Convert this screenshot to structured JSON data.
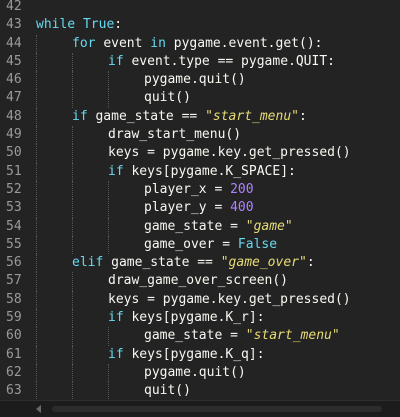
{
  "editor": {
    "lines": [
      {
        "n": "42",
        "indent": 0,
        "tokens": []
      },
      {
        "n": "43",
        "indent": 0,
        "tokens": [
          [
            "kw",
            "while "
          ],
          [
            "kw",
            "True"
          ],
          [
            "pl",
            ":"
          ]
        ]
      },
      {
        "n": "44",
        "indent": 1,
        "tokens": [
          [
            "kw",
            "for "
          ],
          [
            "pl",
            "event "
          ],
          [
            "kw",
            "in "
          ],
          [
            "pl",
            "pygame.event.get():"
          ]
        ]
      },
      {
        "n": "45",
        "indent": 2,
        "tokens": [
          [
            "kw",
            "if "
          ],
          [
            "pl",
            "event.type == pygame.QUIT:"
          ]
        ]
      },
      {
        "n": "46",
        "indent": 3,
        "tokens": [
          [
            "pl",
            "pygame.quit()"
          ]
        ]
      },
      {
        "n": "47",
        "indent": 3,
        "tokens": [
          [
            "pl",
            "quit()"
          ]
        ]
      },
      {
        "n": "48",
        "indent": 1,
        "tokens": [
          [
            "kw",
            "if "
          ],
          [
            "pl",
            "game_state == "
          ],
          [
            "str",
            "\"start_menu\""
          ],
          [
            "pl",
            ":"
          ]
        ]
      },
      {
        "n": "49",
        "indent": 2,
        "tokens": [
          [
            "pl",
            "draw_start_menu()"
          ]
        ]
      },
      {
        "n": "50",
        "indent": 2,
        "tokens": [
          [
            "pl",
            "keys = pygame.key.get_pressed()"
          ]
        ]
      },
      {
        "n": "51",
        "indent": 2,
        "tokens": [
          [
            "kw",
            "if "
          ],
          [
            "pl",
            "keys[pygame.K_SPACE]:"
          ]
        ]
      },
      {
        "n": "52",
        "indent": 3,
        "tokens": [
          [
            "pl",
            "player_x = "
          ],
          [
            "num",
            "200"
          ]
        ]
      },
      {
        "n": "53",
        "indent": 3,
        "tokens": [
          [
            "pl",
            "player_y = "
          ],
          [
            "num",
            "400"
          ]
        ]
      },
      {
        "n": "54",
        "indent": 3,
        "tokens": [
          [
            "pl",
            "game_state = "
          ],
          [
            "str",
            "\"game\""
          ]
        ]
      },
      {
        "n": "55",
        "indent": 3,
        "tokens": [
          [
            "pl",
            "game_over = "
          ],
          [
            "kw",
            "False"
          ]
        ]
      },
      {
        "n": "56",
        "indent": 1,
        "tokens": [
          [
            "kw",
            "elif "
          ],
          [
            "pl",
            "game_state == "
          ],
          [
            "str",
            "\"game_over\""
          ],
          [
            "pl",
            ":"
          ]
        ]
      },
      {
        "n": "57",
        "indent": 2,
        "tokens": [
          [
            "pl",
            "draw_game_over_screen()"
          ]
        ]
      },
      {
        "n": "58",
        "indent": 2,
        "tokens": [
          [
            "pl",
            "keys = pygame.key.get_pressed()"
          ]
        ]
      },
      {
        "n": "59",
        "indent": 2,
        "tokens": [
          [
            "kw",
            "if "
          ],
          [
            "pl",
            "keys[pygame.K_r]:"
          ]
        ]
      },
      {
        "n": "60",
        "indent": 3,
        "tokens": [
          [
            "pl",
            "game_state = "
          ],
          [
            "str",
            "\"start_menu\""
          ]
        ]
      },
      {
        "n": "61",
        "indent": 2,
        "tokens": [
          [
            "kw",
            "if "
          ],
          [
            "pl",
            "keys[pygame.K_q]:"
          ]
        ]
      },
      {
        "n": "62",
        "indent": 3,
        "tokens": [
          [
            "pl",
            "pygame.quit()"
          ]
        ]
      },
      {
        "n": "63",
        "indent": 3,
        "tokens": [
          [
            "pl",
            "quit()"
          ]
        ]
      },
      {
        "n": "64",
        "indent": 0,
        "tokens": []
      }
    ]
  },
  "colors": {
    "background": "#232323",
    "keyword": "#66d9ef",
    "number": "#ae81ff",
    "string": "#e6db74",
    "plain": "#f8f8f2",
    "line_number": "#9a9a9a"
  },
  "icons": {
    "scroll_left": "scroll-left-arrow-icon"
  }
}
